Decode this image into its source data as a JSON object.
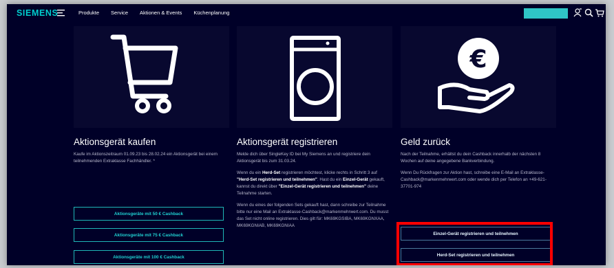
{
  "header": {
    "logo": "SIEMENS",
    "nav": [
      "Produkte",
      "Service",
      "Aktionen & Events",
      "Küchenplanung"
    ]
  },
  "icons": {
    "menu": "hamburger-icon",
    "user": "user-icon",
    "search": "search-icon",
    "cart": "cart-icon"
  },
  "colors": {
    "background": "#000028",
    "accent": "#2fc6c6",
    "highlight": "#ff0000"
  },
  "columns": [
    {
      "icon": "shopping-cart-icon",
      "title": "Aktionsgerät kaufen",
      "paragraphs": [
        "Kaufe im Aktionszeitraum 01.09.23 bis 28.02.24 ein Aktionsgerät bei einem teilnehmenden Extraklasse Fachhändler. *"
      ],
      "buttons": [
        "Aktionsgeräte mit 50 € Cashback",
        "Aktionsgeräte mit 75 € Cashback",
        "Aktionsgeräte mit 100 € Cashback"
      ]
    },
    {
      "icon": "washing-machine-icon",
      "title": "Aktionsgerät registrieren",
      "p1": "Melde dich über SingleKey ID bei My Siemens an und registriere dein Aktionsgerät bis zum 31.03.24.",
      "p2": {
        "a": "Wenn du ein ",
        "b1": "Herd-Set",
        "c": " registrieren möchtest, klicke rechts in Schritt 3 auf ",
        "b2": "\"Herd-Set registrieren und teilnehmen\"",
        "d": ". Hast du ein ",
        "b3": "Einzel-Gerät",
        "e": " gekauft, kannst du direkt über ",
        "b4": "\"Einzel-Gerät registrieren und teilnehmen\"",
        "f": " deine Teilnahme starten."
      },
      "p3": "Wenn du eines der folgenden Sets gekauft hast, dann schreibe zur Teilnahme bitte nur eine Mail an Extraklasse-Cashback@markenmehrwert.com. Du musst das Set nicht online registrieren. Dies gilt für: MK69KGSIBA, MK69KGNXAA, MK69KGNIAB, MK69KGNIAA"
    },
    {
      "icon": "euro-coin-hand-icon",
      "title": "Geld zurück",
      "paragraphs": [
        "Nach der Teilnahme, erhältst du dein Cashback innerhalb der nächsten 8 Wochen auf deine angegebene Bankverbindung.",
        "Wenn Du Rückfragen zur Aktion hast, schreibe eine E-Mail an Extraklasse-Cashback@markenmehrwert.com oder wende dich per Telefon an +49-621-37701-974"
      ],
      "buttons": [
        "Einzel-Gerät registrieren und teilnehmen",
        "Herd-Set registrieren und teilnehmen"
      ]
    }
  ]
}
